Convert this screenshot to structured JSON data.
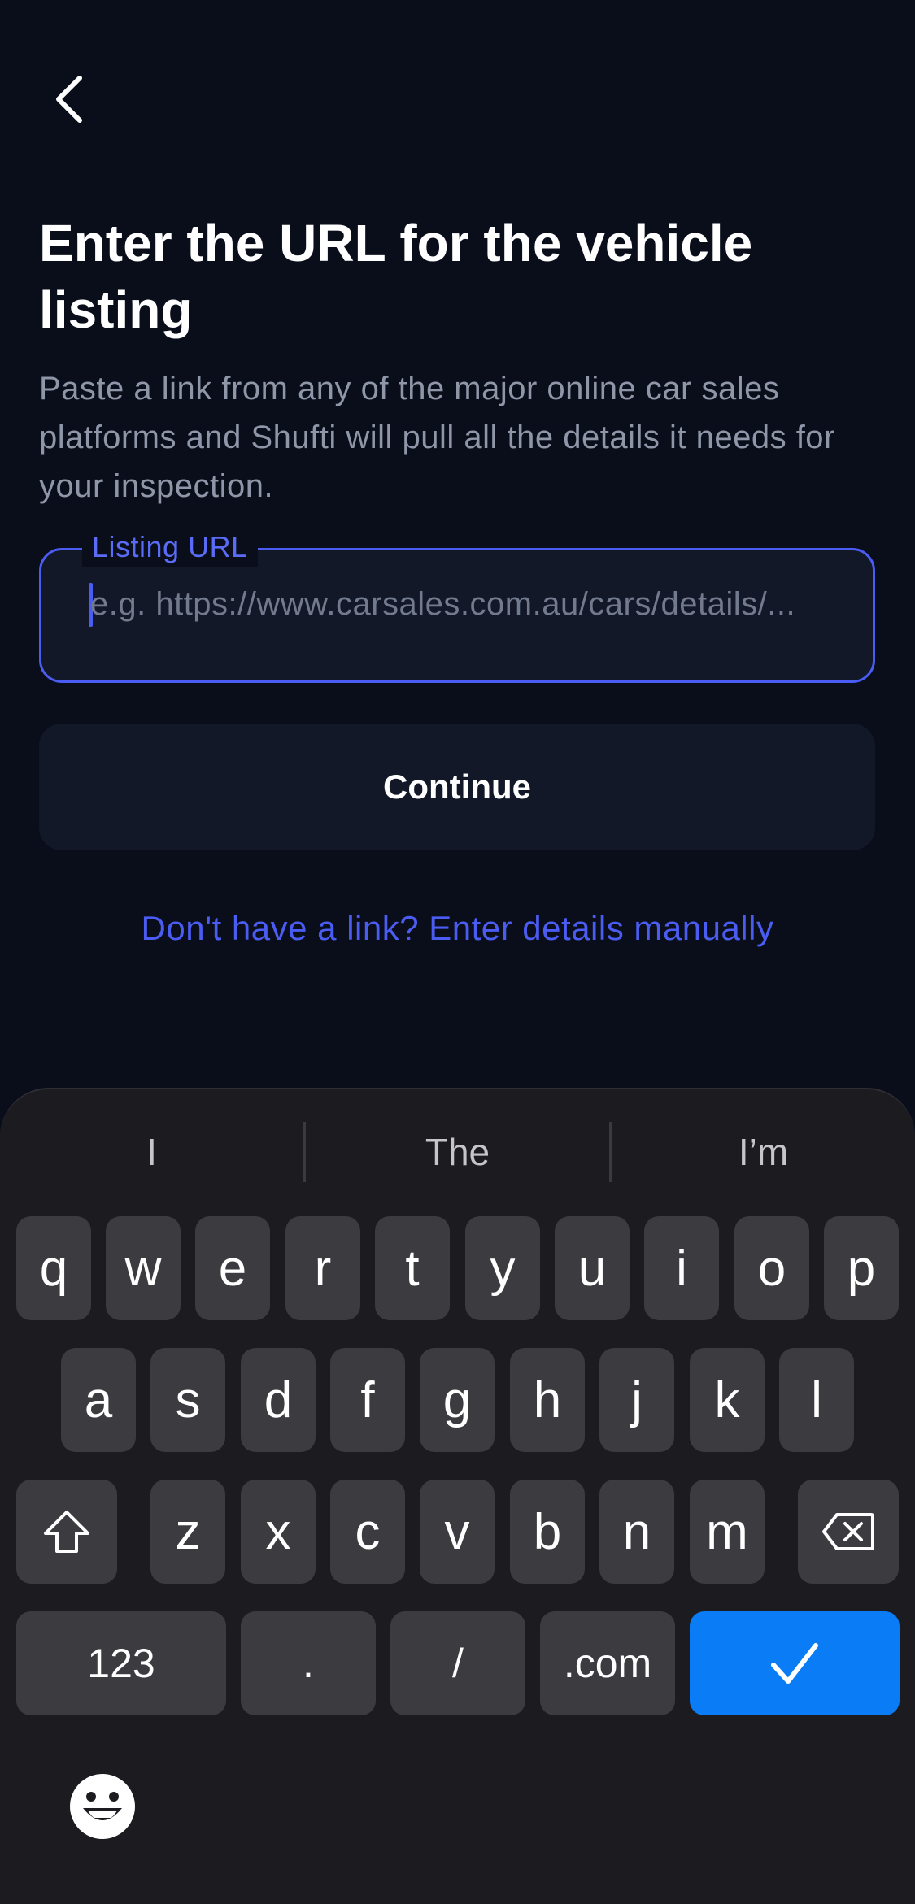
{
  "header": {
    "back_label": "Back"
  },
  "page": {
    "title": "Enter the URL for the vehicle listing",
    "subtitle": "Paste a link from any of the major online car sales platforms and Shufti will pull all the details it needs for your inspection."
  },
  "form": {
    "url_label": "Listing URL",
    "url_placeholder": "e.g. https://www.carsales.com.au/cars/details/...",
    "url_value": "",
    "continue_label": "Continue"
  },
  "links": {
    "manual_entry": "Don't have a link? Enter details manually"
  },
  "keyboard": {
    "suggestions": [
      "I",
      "The",
      "I’m"
    ],
    "row1": [
      "q",
      "w",
      "e",
      "r",
      "t",
      "y",
      "u",
      "i",
      "o",
      "p"
    ],
    "row2": [
      "a",
      "s",
      "d",
      "f",
      "g",
      "h",
      "j",
      "k",
      "l"
    ],
    "row3": [
      "z",
      "x",
      "c",
      "v",
      "b",
      "n",
      "m"
    ],
    "bottom": {
      "numbers": "123",
      "period": ".",
      "slash": "/",
      "dotcom": ".com"
    },
    "icons": {
      "shift": "shift-icon",
      "backspace": "backspace-icon",
      "enter": "checkmark-icon",
      "emoji": "emoji-icon"
    },
    "enter_color": "#0a7cf5"
  },
  "colors": {
    "background": "#0a0e1b",
    "accent": "#4a5cf2",
    "surface": "#121828",
    "muted_text": "#8f96a8"
  }
}
